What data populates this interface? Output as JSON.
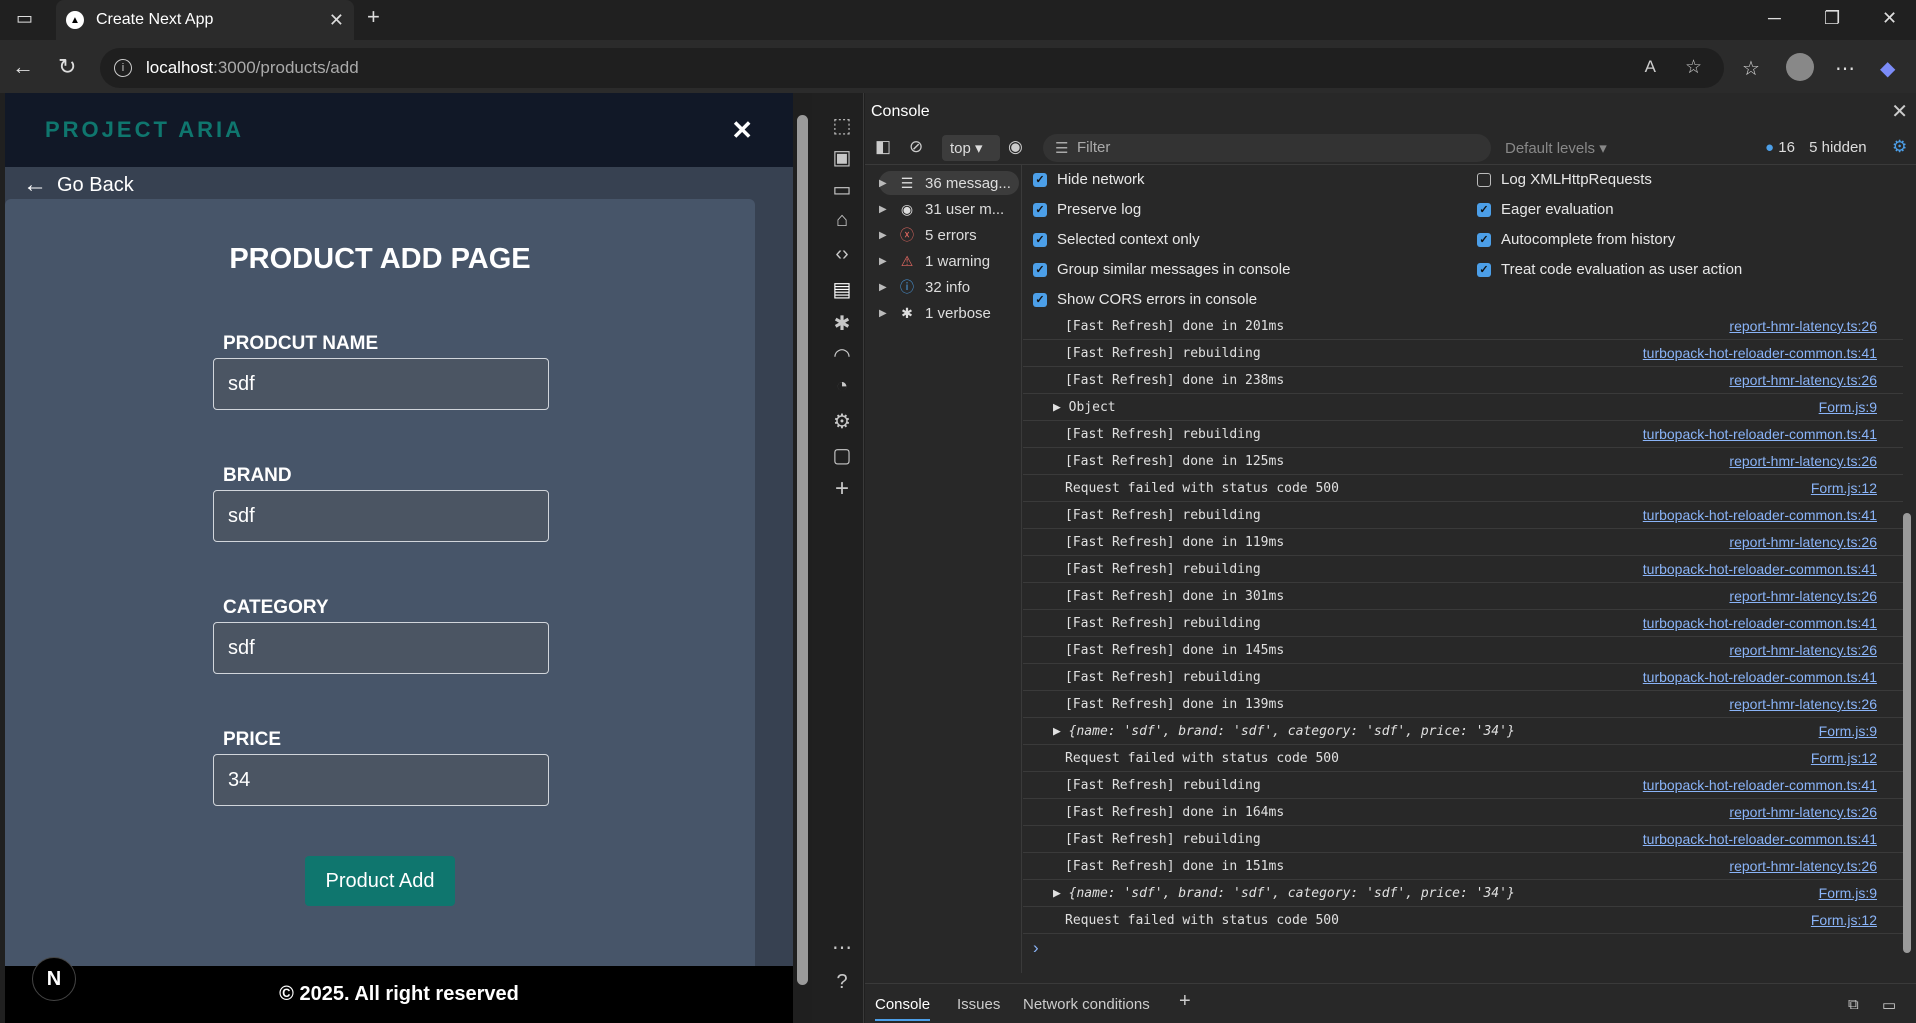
{
  "browser": {
    "tab_title": "Create Next App",
    "url_host": "localhost",
    "url_path": ":3000/products/add"
  },
  "site": {
    "brand": "PROJECT ARIA",
    "back_label": "Go Back",
    "page_title": "PRODUCT ADD PAGE",
    "fields": [
      {
        "label": "PRODCUT NAME",
        "value": "sdf"
      },
      {
        "label": "BRAND",
        "value": "sdf"
      },
      {
        "label": "CATEGORY",
        "value": "sdf"
      },
      {
        "label": "PRICE",
        "value": "34"
      }
    ],
    "submit_label": "Product Add",
    "footer": "© 2025. All right reserved",
    "next_badge": "N"
  },
  "devtools": {
    "title": "Console",
    "context": "top",
    "filter_placeholder": "Filter",
    "levels": "Default levels",
    "issues_count": "16",
    "hidden": "5 hidden",
    "sidebar": [
      {
        "label": "36 messag...",
        "icon": "list-icon"
      },
      {
        "label": "31 user m...",
        "icon": "user-icon"
      },
      {
        "label": "5 errors",
        "icon": "error-icon"
      },
      {
        "label": "1 warning",
        "icon": "warning-icon"
      },
      {
        "label": "32 info",
        "icon": "info-icon"
      },
      {
        "label": "1 verbose",
        "icon": "bug-icon"
      }
    ],
    "settings_left": [
      {
        "label": "Hide network",
        "checked": true
      },
      {
        "label": "Preserve log",
        "checked": true
      },
      {
        "label": "Selected context only",
        "checked": true
      },
      {
        "label": "Group similar messages in console",
        "checked": true
      },
      {
        "label": "Show CORS errors in console",
        "checked": true
      }
    ],
    "settings_right": [
      {
        "label": "Log XMLHttpRequests",
        "checked": false
      },
      {
        "label": "Eager evaluation",
        "checked": true
      },
      {
        "label": "Autocomplete from history",
        "checked": true
      },
      {
        "label": "Treat code evaluation as user action",
        "checked": true
      }
    ],
    "log": [
      {
        "msg": "[Fast Refresh] done in 201ms",
        "src": "report-hmr-latency.ts:26"
      },
      {
        "msg": "[Fast Refresh] rebuilding",
        "src": "turbopack-hot-reloader-common.ts:41"
      },
      {
        "msg": "[Fast Refresh] done in 238ms",
        "src": "report-hmr-latency.ts:26"
      },
      {
        "msg": "▶ Object",
        "src": "Form.js:9"
      },
      {
        "msg": "[Fast Refresh] rebuilding",
        "src": "turbopack-hot-reloader-common.ts:41"
      },
      {
        "msg": "[Fast Refresh] done in 125ms",
        "src": "report-hmr-latency.ts:26"
      },
      {
        "msg": "Request failed with status code 500",
        "src": "Form.js:12"
      },
      {
        "msg": "[Fast Refresh] rebuilding",
        "src": "turbopack-hot-reloader-common.ts:41"
      },
      {
        "msg": "[Fast Refresh] done in 119ms",
        "src": "report-hmr-latency.ts:26"
      },
      {
        "msg": "[Fast Refresh] rebuilding",
        "src": "turbopack-hot-reloader-common.ts:41"
      },
      {
        "msg": "[Fast Refresh] done in 301ms",
        "src": "report-hmr-latency.ts:26"
      },
      {
        "msg": "[Fast Refresh] rebuilding",
        "src": "turbopack-hot-reloader-common.ts:41"
      },
      {
        "msg": "[Fast Refresh] done in 145ms",
        "src": "report-hmr-latency.ts:26"
      },
      {
        "msg": "[Fast Refresh] rebuilding",
        "src": "turbopack-hot-reloader-common.ts:41"
      },
      {
        "msg": "[Fast Refresh] done in 139ms",
        "src": "report-hmr-latency.ts:26"
      },
      {
        "msg": "▶ {name: 'sdf', brand: 'sdf', category: 'sdf', price: '34'}",
        "src": "Form.js:9"
      },
      {
        "msg": "Request failed with status code 500",
        "src": "Form.js:12"
      },
      {
        "msg": "[Fast Refresh] rebuilding",
        "src": "turbopack-hot-reloader-common.ts:41"
      },
      {
        "msg": "[Fast Refresh] done in 164ms",
        "src": "report-hmr-latency.ts:26"
      },
      {
        "msg": "[Fast Refresh] rebuilding",
        "src": "turbopack-hot-reloader-common.ts:41"
      },
      {
        "msg": "[Fast Refresh] done in 151ms",
        "src": "report-hmr-latency.ts:26"
      },
      {
        "msg": "▶ {name: 'sdf', brand: 'sdf', category: 'sdf', price: '34'}",
        "src": "Form.js:9"
      },
      {
        "msg": "Request failed with status code 500",
        "src": "Form.js:12"
      }
    ],
    "drawer_tabs": [
      "Console",
      "Issues",
      "Network conditions"
    ]
  }
}
